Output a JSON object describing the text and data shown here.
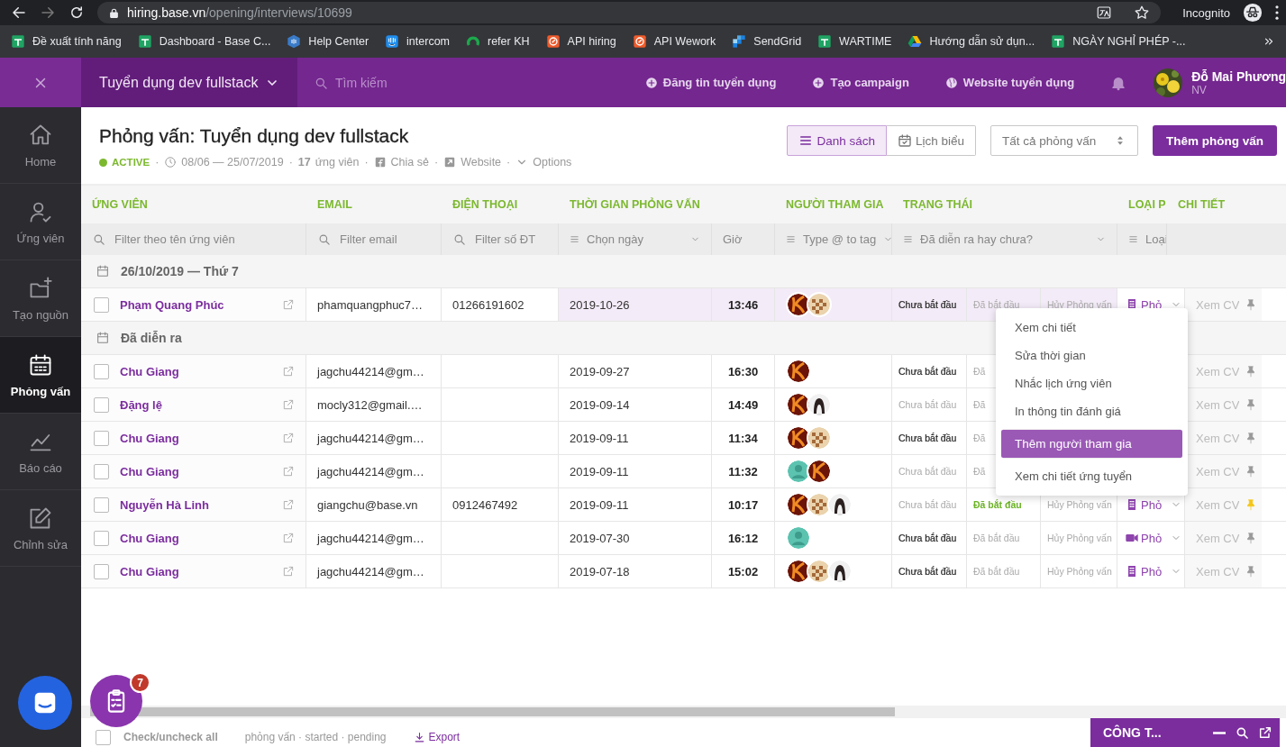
{
  "browser": {
    "url_host": "hiring.base.vn",
    "url_path": "/opening/interviews/10699",
    "profile": "Incognito",
    "bookmarks": [
      {
        "label": "Đề xuất tính năng",
        "kind": "sheets"
      },
      {
        "label": "Dashboard - Base C...",
        "kind": "sheets"
      },
      {
        "label": "Help Center",
        "kind": "hexagon"
      },
      {
        "label": "intercom",
        "kind": "intercom"
      },
      {
        "label": "refer KH",
        "kind": "ring"
      },
      {
        "label": "API hiring",
        "kind": "api"
      },
      {
        "label": "API Wework",
        "kind": "api"
      },
      {
        "label": "SendGrid",
        "kind": "sendgrid"
      },
      {
        "label": "WARTIME",
        "kind": "sheets"
      },
      {
        "label": "Hướng dẫn sử dụn...",
        "kind": "drive"
      },
      {
        "label": "NGÀY NGHỈ PHÉP -...",
        "kind": "sheets"
      }
    ]
  },
  "topbar": {
    "project": "Tuyển dụng dev fullstack",
    "search": {
      "placeholder": "Tìm kiếm"
    },
    "actions": [
      {
        "label": "Đăng tin tuyển dụng",
        "kind": "plus"
      },
      {
        "label": "Tạo campaign",
        "kind": "plus"
      },
      {
        "label": "Website tuyển dụng",
        "kind": "globe"
      }
    ],
    "user": {
      "name": "Đỗ Mai Phương",
      "role": "NV"
    }
  },
  "sidebar": {
    "items": [
      {
        "label": "Home",
        "kind": "home",
        "selected": false
      },
      {
        "label": "Ứng viên",
        "kind": "candidates",
        "selected": false
      },
      {
        "label": "Tạo nguồn",
        "kind": "sourcing",
        "selected": false
      },
      {
        "label": "Phỏng vấn",
        "kind": "interviews",
        "selected": true
      },
      {
        "label": "Báo cáo",
        "kind": "reports",
        "selected": false
      },
      {
        "label": "Chỉnh sửa",
        "kind": "edit",
        "selected": false
      }
    ]
  },
  "header": {
    "title": "Phỏng vấn: Tuyển dụng dev fullstack",
    "meta": [
      {
        "kind": "status",
        "label": "ACTIVE"
      },
      {
        "kind": "sep",
        "label": "·"
      },
      {
        "kind": "dates",
        "label": "08/06 — 25/07/2019"
      },
      {
        "kind": "sep",
        "label": "·"
      },
      {
        "kind": "count",
        "label": "**17** ứng viên"
      },
      {
        "kind": "sep",
        "label": "·"
      },
      {
        "kind": "share",
        "label": "Chia sẻ"
      },
      {
        "kind": "sep",
        "label": "·"
      },
      {
        "kind": "website",
        "label": "Website"
      },
      {
        "kind": "sep",
        "label": "·"
      },
      {
        "kind": "options",
        "label": "Options"
      }
    ],
    "views": [
      {
        "label": "Danh sách",
        "kind": "list",
        "selected": true
      },
      {
        "label": "Lịch biểu",
        "kind": "calendar",
        "selected": false
      }
    ],
    "filter": "Tất cả phỏng vấn",
    "add_button": "Thêm phỏng vấn"
  },
  "table": {
    "columns": [
      "ỨNG VIÊN",
      "EMAIL",
      "ĐIỆN THOẠI",
      "THỜI GIAN PHỎNG VẤN",
      "NGƯỜI THAM GIA",
      "TRẠNG THÁI",
      "LOẠI P",
      "CHI TIẾT"
    ],
    "filters": [
      {
        "kind": "search",
        "placeholder": "Filter theo tên ứng viên"
      },
      {
        "kind": "search",
        "placeholder": "Filter email"
      },
      {
        "kind": "search",
        "placeholder": "Filter số ĐT"
      },
      {
        "kind": "select",
        "label": "Chọn ngày",
        "chevron": true
      },
      {
        "kind": "text",
        "label": "Giờ"
      },
      {
        "kind": "select",
        "label": "Type @ to tag",
        "chevron": true
      },
      {
        "kind": "select",
        "label": "Đã diễn ra hay chưa?",
        "chevron": true
      },
      {
        "kind": "select",
        "label": "Loại",
        "chevron": false
      }
    ],
    "groups": [
      {
        "title": "26/10/2019 — Thứ 7",
        "rows": [
          {
            "name": "Phạm Quang Phúc",
            "email": "phamquangphuc7…",
            "phone": "01266191602",
            "date": "2019-10-26",
            "time": "13:46",
            "participants": [
              {
                "kind": "flame"
              },
              {
                "kind": "chess"
              }
            ],
            "stages": [
              {
                "kind": "pending",
                "label": "Chưa bắt đầu",
                "selected": true
              },
              {
                "kind": "started",
                "label": "Đã bắt đầu",
                "selected": false
              },
              {
                "kind": "cancel",
                "label": "Hủy Phỏng vấn",
                "selected": false
              }
            ],
            "type": {
              "kind": "building",
              "label": "Phỏ"
            },
            "detail": "Xem CV",
            "pinned": false,
            "checked": false,
            "selected": true
          }
        ]
      },
      {
        "title": "Đã diễn ra",
        "rows": [
          {
            "name": "Chu Giang",
            "email": "jagchu44214@gm…",
            "date": "2019-09-27",
            "time": "16:30",
            "participants": [
              {
                "kind": "flame"
              }
            ],
            "stages": [
              {
                "kind": "pending",
                "label": "Chưa bắt đầu",
                "selected": true
              },
              {
                "kind": "started",
                "label": "Đã",
                "selected": false
              }
            ],
            "detail": "Xem CV",
            "pinned": false,
            "checked": false,
            "selected": false
          },
          {
            "name": "Đặng lệ",
            "email": "mocly312@gmail.…",
            "date": "2019-09-14",
            "time": "14:49",
            "participants": [
              {
                "kind": "flame"
              },
              {
                "kind": "woman"
              }
            ],
            "stages": [
              {
                "kind": "pending",
                "label": "Chưa bắt đầu",
                "selected": false
              },
              {
                "kind": "started",
                "label": "Đã",
                "selected": false
              }
            ],
            "detail": "Xem CV",
            "pinned": false,
            "checked": false,
            "selected": false
          },
          {
            "name": "Chu Giang",
            "email": "jagchu44214@gm…",
            "date": "2019-09-11",
            "time": "11:34",
            "participants": [
              {
                "kind": "flame"
              },
              {
                "kind": "chess"
              }
            ],
            "stages": [
              {
                "kind": "pending",
                "label": "Chưa bắt đầu",
                "selected": true
              },
              {
                "kind": "started",
                "label": "Đã",
                "selected": false
              }
            ],
            "detail": "Xem CV",
            "pinned": false,
            "checked": false,
            "selected": false
          },
          {
            "name": "Chu Giang",
            "email": "jagchu44214@gm…",
            "date": "2019-09-11",
            "time": "11:32",
            "participants": [
              {
                "kind": "person"
              },
              {
                "kind": "flame"
              }
            ],
            "stages": [
              {
                "kind": "pending",
                "label": "Chưa bắt đầu",
                "selected": false
              },
              {
                "kind": "started",
                "label": "Đã",
                "selected": false
              }
            ],
            "detail": "Xem CV",
            "pinned": false,
            "checked": false,
            "selected": false
          },
          {
            "name": "Nguyễn Hà Linh",
            "email": "giangchu@base.vn",
            "phone": "0912467492",
            "date": "2019-09-11",
            "time": "10:17",
            "participants": [
              {
                "kind": "flame"
              },
              {
                "kind": "chess"
              },
              {
                "kind": "woman"
              }
            ],
            "stages": [
              {
                "kind": "pending",
                "label": "Chưa bắt đầu",
                "selected": false
              },
              {
                "kind": "started",
                "label": "Đã bắt đầu",
                "selected": true
              },
              {
                "kind": "cancel",
                "label": "Hủy Phỏng vấn",
                "selected": false
              }
            ],
            "type": {
              "kind": "building",
              "label": "Phỏ"
            },
            "detail": "Xem CV",
            "pinned": true,
            "checked": false,
            "selected": false
          },
          {
            "name": "Chu Giang",
            "email": "jagchu44214@gm…",
            "date": "2019-07-30",
            "time": "16:12",
            "participants": [
              {
                "kind": "person"
              }
            ],
            "stages": [
              {
                "kind": "pending",
                "label": "Chưa bắt đầu",
                "selected": true
              },
              {
                "kind": "started",
                "label": "Đã bắt đầu",
                "selected": false
              },
              {
                "kind": "cancel",
                "label": "Hủy Phỏng vấn",
                "selected": false
              }
            ],
            "type": {
              "kind": "video",
              "label": "Phỏ"
            },
            "detail": "Xem CV",
            "pinned": false,
            "checked": false,
            "selected": false
          },
          {
            "name": "Chu Giang",
            "email": "jagchu44214@gm…",
            "date": "2019-07-18",
            "time": "15:02",
            "participants": [
              {
                "kind": "flame"
              },
              {
                "kind": "chess"
              },
              {
                "kind": "woman"
              }
            ],
            "stages": [
              {
                "kind": "pending",
                "label": "Chưa bắt đầu",
                "selected": true
              },
              {
                "kind": "started",
                "label": "Đã bắt đầu",
                "selected": false
              },
              {
                "kind": "cancel",
                "label": "Hủy Phỏng vấn",
                "selected": false
              }
            ],
            "type": {
              "kind": "building",
              "label": "Phỏ"
            },
            "detail": "Xem CV",
            "pinned": false,
            "checked": false,
            "selected": false
          }
        ]
      }
    ]
  },
  "menu": {
    "items": [
      {
        "label": "Xem chi tiết",
        "selected": false
      },
      {
        "label": "Sửa thời gian",
        "selected": false
      },
      {
        "label": "Nhắc lịch ứng viên",
        "selected": false
      },
      {
        "label": "In thông tin đánh giá",
        "selected": false
      },
      {
        "label": "Thêm người tham gia",
        "selected": true
      },
      {
        "label": "Xem chi tiết ứng tuyển",
        "selected": false
      }
    ]
  },
  "footer": {
    "checked": false,
    "check_all": "Check/uncheck all",
    "legend": "phỏng vấn · started · pending",
    "export": "Export"
  },
  "launcher": {
    "badge": "7"
  },
  "dock": {
    "title": "CÔNG T..."
  }
}
